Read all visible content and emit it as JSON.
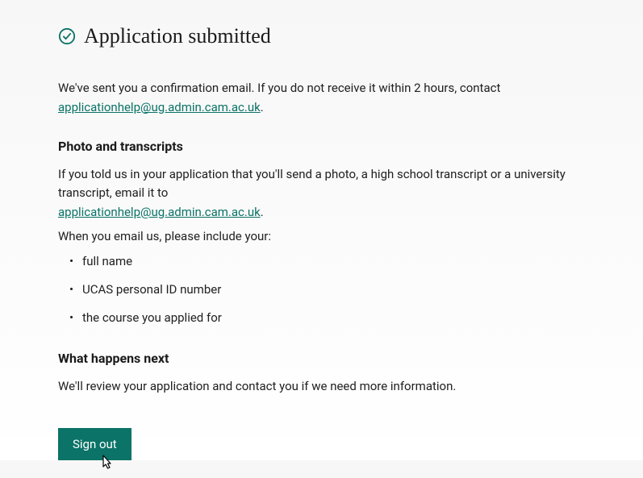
{
  "header": {
    "title": "Application submitted"
  },
  "intro": {
    "text": "We've sent you a confirmation email. If you do not receive it within 2 hours, contact",
    "link": "applicationhelp@ug.admin.cam.ac.uk",
    "period": "."
  },
  "photo_section": {
    "title": "Photo and transcripts",
    "text": "If you told us in your application that you'll send a photo, a high school transcript or a university transcript, email it to",
    "link": "applicationhelp@ug.admin.cam.ac.uk",
    "period": ".",
    "list_intro": "When you email us, please include your:",
    "items": [
      "full name",
      "UCAS personal ID number",
      "the course you applied for"
    ]
  },
  "next_section": {
    "title": "What happens next",
    "text": "We'll review your application and contact you if we need more information."
  },
  "button": {
    "signout": "Sign out"
  },
  "colors": {
    "primary": "#0b7367"
  }
}
